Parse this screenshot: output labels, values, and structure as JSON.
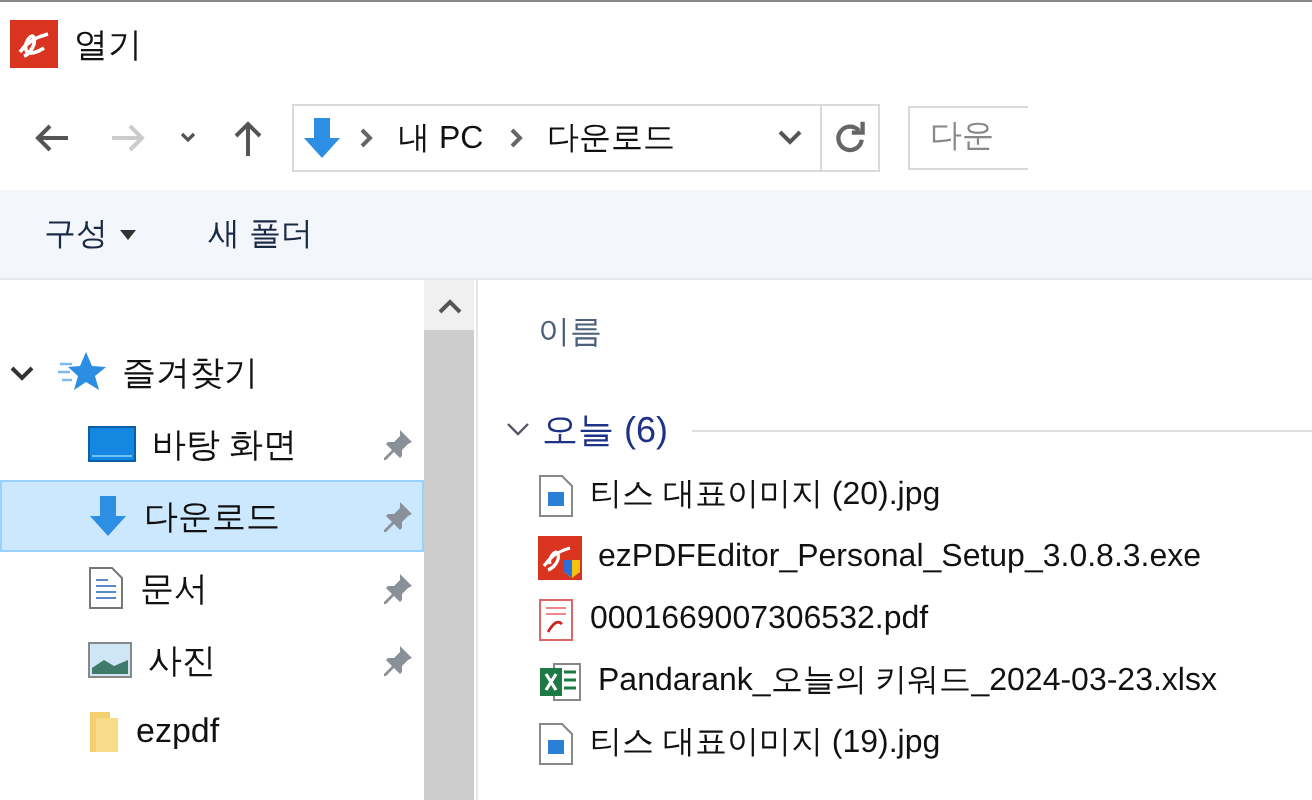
{
  "window": {
    "title": "열기"
  },
  "nav": {
    "back_disabled": false,
    "forward_disabled": true,
    "breadcrumb": [
      "내 PC",
      "다운로드"
    ],
    "search": {
      "placeholder": "다운"
    }
  },
  "toolbar": {
    "buttons": [
      {
        "label": "구성",
        "dropdown": true
      },
      {
        "label": "새 폴더",
        "dropdown": false
      }
    ]
  },
  "sidebar": {
    "items": [
      {
        "label": "즐겨찾기",
        "expanded": true,
        "children": [
          {
            "label": "바탕 화면",
            "kind": "desktop",
            "pinned": true,
            "selected": false
          },
          {
            "label": "다운로드",
            "kind": "download",
            "pinned": true,
            "selected": true
          },
          {
            "label": "문서",
            "kind": "document",
            "pinned": true,
            "selected": false
          },
          {
            "label": "사진",
            "kind": "pictures",
            "pinned": true,
            "selected": false
          },
          {
            "label": "ezpdf",
            "kind": "folder",
            "pinned": false,
            "selected": false
          }
        ]
      }
    ]
  },
  "file_list": {
    "columns": [
      "이름"
    ],
    "groups": [
      {
        "label": "오늘 (6)",
        "expanded": true,
        "files": [
          {
            "name": "티스 대표이미지 (20).jpg",
            "kind": "image"
          },
          {
            "name": "ezPDFEditor_Personal_Setup_3.0.8.3.exe",
            "kind": "installer"
          },
          {
            "name": "0001669007306532.pdf",
            "kind": "pdf"
          },
          {
            "name": "Pandarank_오늘의 키워드_2024-03-23.xlsx",
            "kind": "excel"
          },
          {
            "name": "티스 대표이미지 (19).jpg",
            "kind": "image"
          }
        ]
      }
    ]
  }
}
